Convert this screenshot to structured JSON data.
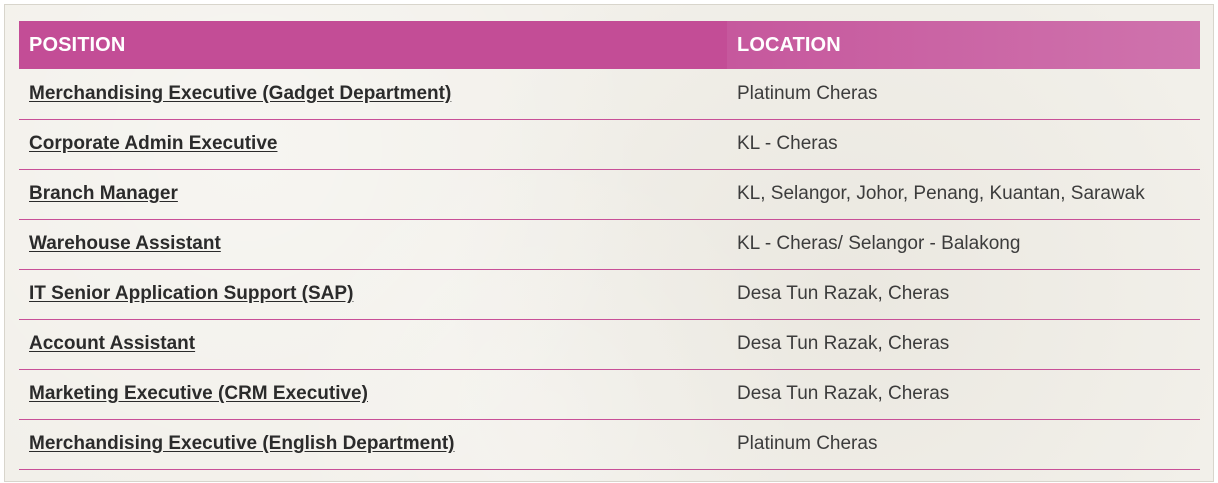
{
  "table": {
    "headers": {
      "position": "POSITION",
      "location": "LOCATION"
    },
    "rows": [
      {
        "position": "Merchandising Executive (Gadget Department)",
        "location": "Platinum Cheras"
      },
      {
        "position": "Corporate Admin Executive",
        "location": "KL - Cheras"
      },
      {
        "position": "Branch Manager",
        "location": "KL, Selangor, Johor, Penang, Kuantan, Sarawak"
      },
      {
        "position": "Warehouse Assistant",
        "location": "KL - Cheras/ Selangor - Balakong"
      },
      {
        "position": "IT Senior Application Support (SAP)",
        "location": "Desa Tun Razak, Cheras"
      },
      {
        "position": "Account Assistant",
        "location": "Desa Tun Razak, Cheras"
      },
      {
        "position": "Marketing Executive (CRM Executive)",
        "location": "Desa Tun Razak, Cheras"
      },
      {
        "position": "Merchandising Executive (English Department)",
        "location": "Platinum Cheras"
      }
    ]
  },
  "colors": {
    "header_bg": "#c34d96",
    "row_divider": "#c84f97",
    "link_text": "#2b2b2b",
    "background": "#f2f0ea"
  }
}
